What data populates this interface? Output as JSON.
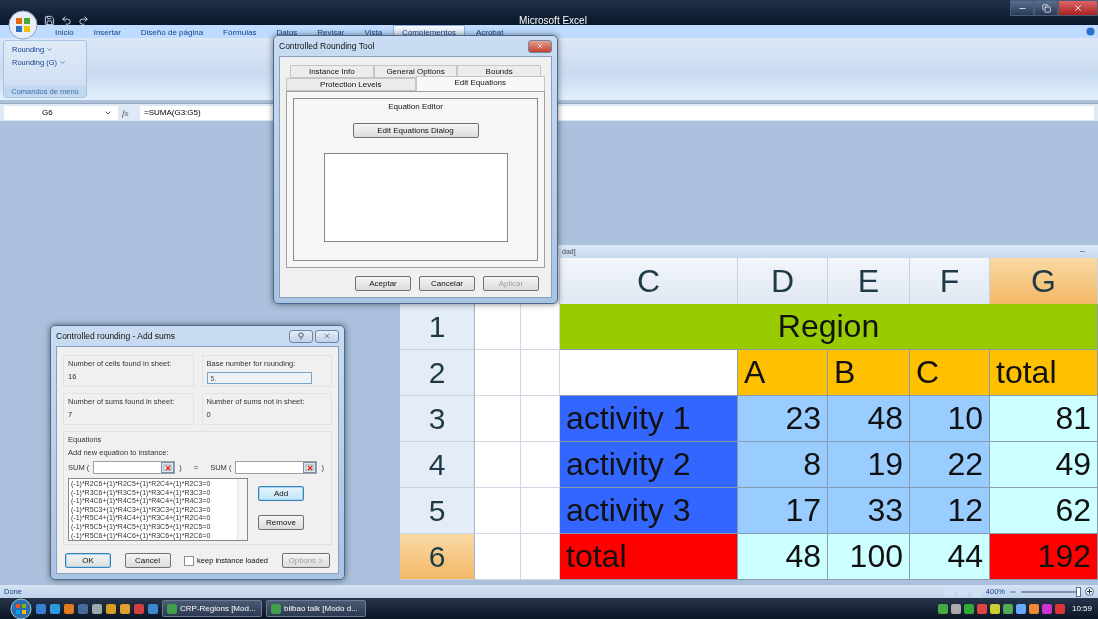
{
  "window": {
    "title": "Microsoft Excel"
  },
  "ribbon_tabs": [
    {
      "label": "Inicio",
      "selected": false
    },
    {
      "label": "Insertar",
      "selected": false
    },
    {
      "label": "Diseño de página",
      "selected": false
    },
    {
      "label": "Fórmulas",
      "selected": false
    },
    {
      "label": "Datos",
      "selected": false
    },
    {
      "label": "Revisar",
      "selected": false
    },
    {
      "label": "Vista",
      "selected": false
    },
    {
      "label": "Complementos",
      "selected": true
    },
    {
      "label": "Acrobat",
      "selected": false
    }
  ],
  "ribbon_group": {
    "buttons": [
      "Rounding",
      "Rounding (G)"
    ],
    "label": "Comandos de menú"
  },
  "formula_bar": {
    "name_box": "G6",
    "fx_label": "fx",
    "formula": "=SUMA(G3:G5)"
  },
  "sheet": {
    "title": "dad]",
    "columns": [
      {
        "label": "C",
        "selected": false
      },
      {
        "label": "D",
        "selected": false
      },
      {
        "label": "E",
        "selected": false
      },
      {
        "label": "F",
        "selected": false
      },
      {
        "label": "G",
        "selected": true
      }
    ],
    "rows": [
      {
        "header": "1",
        "selected": false,
        "kind": "banner",
        "banner": {
          "text": "Region",
          "color": "#99cc00"
        }
      },
      {
        "header": "2",
        "selected": false,
        "kind": "cells",
        "cells": [
          {
            "kind": "text",
            "color": "#ffffff"
          },
          {
            "text": "A",
            "kind": "text",
            "color": "#ffc000"
          },
          {
            "text": "B",
            "kind": "text",
            "color": "#ffc000"
          },
          {
            "text": "C",
            "kind": "text",
            "color": "#ffc000"
          },
          {
            "text": "total",
            "kind": "text",
            "color": "#ffc000"
          }
        ]
      },
      {
        "header": "3",
        "selected": false,
        "kind": "cells",
        "cells": [
          {
            "text": "activity 1",
            "kind": "text",
            "color": "#3366ff"
          },
          {
            "text": "23",
            "kind": "number",
            "color": "#99ccff"
          },
          {
            "text": "48",
            "kind": "number",
            "color": "#99ccff"
          },
          {
            "text": "10",
            "kind": "number",
            "color": "#99ccff"
          },
          {
            "text": "81",
            "kind": "number",
            "color": "#ccffff"
          }
        ]
      },
      {
        "header": "4",
        "selected": false,
        "kind": "cells",
        "cells": [
          {
            "text": "activity 2",
            "kind": "text",
            "color": "#3366ff"
          },
          {
            "text": "8",
            "kind": "number",
            "color": "#99ccff"
          },
          {
            "text": "19",
            "kind": "number",
            "color": "#99ccff"
          },
          {
            "text": "22",
            "kind": "number",
            "color": "#99ccff"
          },
          {
            "text": "49",
            "kind": "number",
            "color": "#ccffff"
          }
        ]
      },
      {
        "header": "5",
        "selected": false,
        "kind": "cells",
        "cells": [
          {
            "text": "activity 3",
            "kind": "text",
            "color": "#3366ff"
          },
          {
            "text": "17",
            "kind": "number",
            "color": "#99ccff"
          },
          {
            "text": "33",
            "kind": "number",
            "color": "#99ccff"
          },
          {
            "text": "12",
            "kind": "number",
            "color": "#99ccff"
          },
          {
            "text": "62",
            "kind": "number",
            "color": "#ccffff"
          }
        ]
      },
      {
        "header": "6",
        "selected": true,
        "kind": "cells",
        "cells": [
          {
            "text": "total",
            "kind": "text",
            "color": "#ff0000"
          },
          {
            "text": "48",
            "kind": "number",
            "color": "#ccffff"
          },
          {
            "text": "100",
            "kind": "number",
            "color": "#ccffff"
          },
          {
            "text": "44",
            "kind": "number",
            "color": "#ccffff"
          },
          {
            "text": "192",
            "kind": "number",
            "color": "#ff0000"
          }
        ]
      }
    ]
  },
  "status_bar": {
    "text": "Done",
    "zoom": "400%",
    "zoom_slider": {
      "level": 1
    }
  },
  "taskbar": {
    "tasks": [
      {
        "label": "CRP-Regions [Mod...",
        "selected": false
      },
      {
        "label": "bilbao talk [Modo d...",
        "selected": false
      }
    ],
    "clock": "10:59"
  },
  "rounding_tool": {
    "title": "Controlled Rounding Tool",
    "tab_rows": [
      [
        {
          "label": "Instance Info",
          "selected": false
        },
        {
          "label": "General Options",
          "selected": false
        },
        {
          "label": "Bounds",
          "selected": false
        }
      ],
      [
        {
          "label": "Protection Levels",
          "selected": false
        },
        {
          "label": "Edit Equations",
          "selected": true
        }
      ]
    ],
    "group_title": "Equation Editor",
    "editor_button": "Edit Equations Dialog",
    "buttons": [
      {
        "label": "Aceptar",
        "disabled": false
      },
      {
        "label": "Cancelar",
        "disabled": false
      },
      {
        "label": "Aplicar",
        "disabled": true
      }
    ]
  },
  "add_sums": {
    "title": "Controlled rounding - Add sums",
    "info": [
      {
        "label": "Number of cells found in sheet:",
        "value": "16",
        "kind": "text"
      },
      {
        "label": "Base number for rounding:",
        "value": "5.",
        "kind": "input"
      },
      {
        "label": "Number of sums found in sheet:",
        "value": "7",
        "kind": "text"
      },
      {
        "label": "Number of sums not in sheet:",
        "value": "0",
        "kind": "text"
      }
    ],
    "equations_title": "Equations",
    "prompt": "Add new equation to instance:",
    "sum_row": {
      "left": "SUM (",
      "left_close": ")",
      "equals": "=",
      "right": "SUM (",
      "right_close": ")"
    },
    "equations": [
      "(-1)*R2C6+(1)*R2C5+(1)*R2C4+(1)*R2C3=0",
      "(-1)*R3C6+(1)*R3C5+(1)*R3C4+(1)*R3C3=0",
      "(-1)*R4C6+(1)*R4C5+(1)*R4C4+(1)*R4C3=0",
      "(-1)*R5C3+(1)*R4C3+(1)*R3C3+(1)*R2C3=0",
      "(-1)*R5C4+(1)*R4C4+(1)*R3C4+(1)*R2C4=0",
      "(-1)*R5C5+(1)*R4C5+(1)*R3C5+(1)*R2C5=0",
      "(-1)*R5C6+(1)*R4C6+(1)*R3C6+(1)*R2C6=0"
    ],
    "side_buttons": [
      {
        "label": "Add",
        "default": true
      },
      {
        "label": "Remove",
        "default": false
      }
    ],
    "footer_buttons": [
      {
        "label": "OK",
        "default": true,
        "disabled": false
      },
      {
        "label": "Cancel",
        "default": false,
        "disabled": false
      },
      {
        "label": "Options >",
        "default": false,
        "disabled": true
      }
    ],
    "keep_loaded": {
      "label": "keep instance loaded",
      "checked": false
    }
  }
}
